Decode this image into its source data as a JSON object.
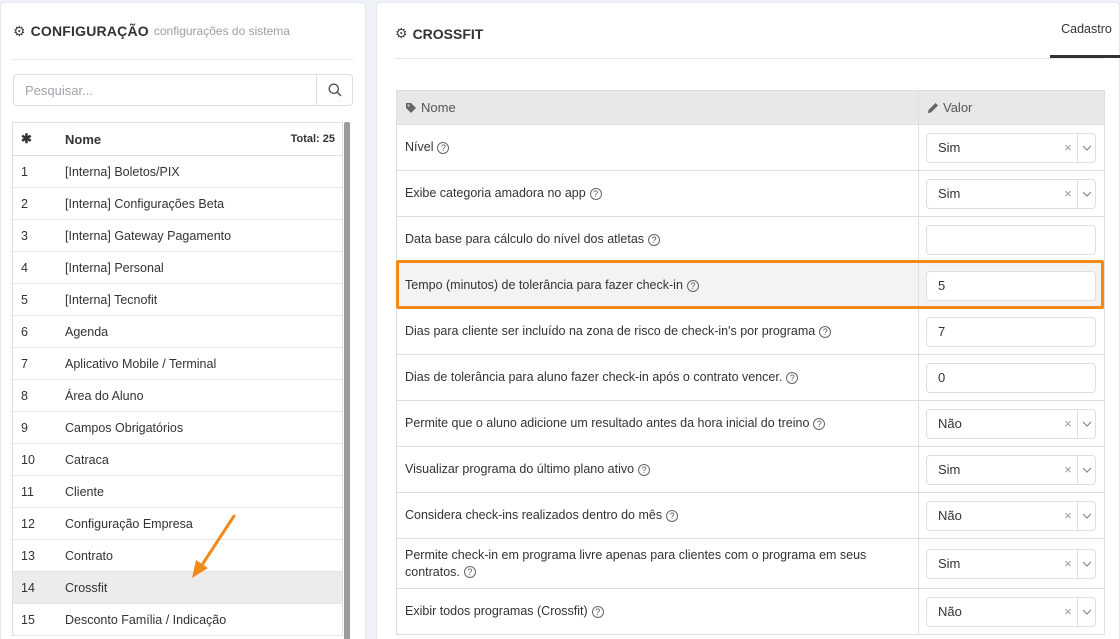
{
  "left": {
    "title": "CONFIGURAÇÃO",
    "subtitle": "configurações do sistema",
    "search_placeholder": "Pesquisar...",
    "table_header": {
      "col_icon": "✱",
      "col_name": "Nome",
      "total": "Total: 25"
    },
    "items": [
      {
        "num": "1",
        "name": "[Interna] Boletos/PIX"
      },
      {
        "num": "2",
        "name": "[Interna] Configurações Beta"
      },
      {
        "num": "3",
        "name": "[Interna] Gateway Pagamento"
      },
      {
        "num": "4",
        "name": "[Interna] Personal"
      },
      {
        "num": "5",
        "name": "[Interna] Tecnofit"
      },
      {
        "num": "6",
        "name": "Agenda"
      },
      {
        "num": "7",
        "name": "Aplicativo Mobile / Terminal"
      },
      {
        "num": "8",
        "name": "Área do Aluno"
      },
      {
        "num": "9",
        "name": "Campos Obrigatórios"
      },
      {
        "num": "10",
        "name": "Catraca"
      },
      {
        "num": "11",
        "name": "Cliente"
      },
      {
        "num": "12",
        "name": "Configuração Empresa"
      },
      {
        "num": "13",
        "name": "Contrato"
      },
      {
        "num": "14",
        "name": "Crossfit",
        "active": true
      },
      {
        "num": "15",
        "name": "Desconto Família / Indicação"
      }
    ]
  },
  "right": {
    "title": "CROSSFIT",
    "tab": "Cadastro",
    "col_name": "Nome",
    "col_value": "Valor",
    "rows": [
      {
        "label": "Nível",
        "type": "select",
        "value": "Sim"
      },
      {
        "label": "Exibe categoria amadora no app",
        "type": "select",
        "value": "Sim"
      },
      {
        "label": "Data base para cálculo do nível dos atletas",
        "type": "input",
        "value": ""
      },
      {
        "label": "Tempo (minutos) de tolerância para fazer check-in",
        "type": "input",
        "value": "5",
        "highlight": true
      },
      {
        "label": "Dias para cliente ser incluído na zona de risco de check-in's por programa",
        "type": "input",
        "value": "7"
      },
      {
        "label": "Dias de tolerância para aluno fazer check-in após o contrato vencer.",
        "type": "input",
        "value": "0"
      },
      {
        "label": "Permite que o aluno adicione um resultado antes da hora inicial do treino",
        "type": "select",
        "value": "Não"
      },
      {
        "label": "Visualizar programa do último plano ativo",
        "type": "select",
        "value": "Sim"
      },
      {
        "label": "Considera check-ins realizados dentro do mês",
        "type": "select",
        "value": "Não"
      },
      {
        "label": "Permite check-in em programa livre apenas para clientes com o programa em seus contratos.",
        "type": "select",
        "value": "Sim",
        "tall": true
      },
      {
        "label": "Exibir todos programas (Crossfit)",
        "type": "select",
        "value": "Não"
      }
    ]
  },
  "colors": {
    "highlight": "#f28a1a",
    "active_row": "#ececec",
    "header_bg": "#e8e8e8"
  }
}
